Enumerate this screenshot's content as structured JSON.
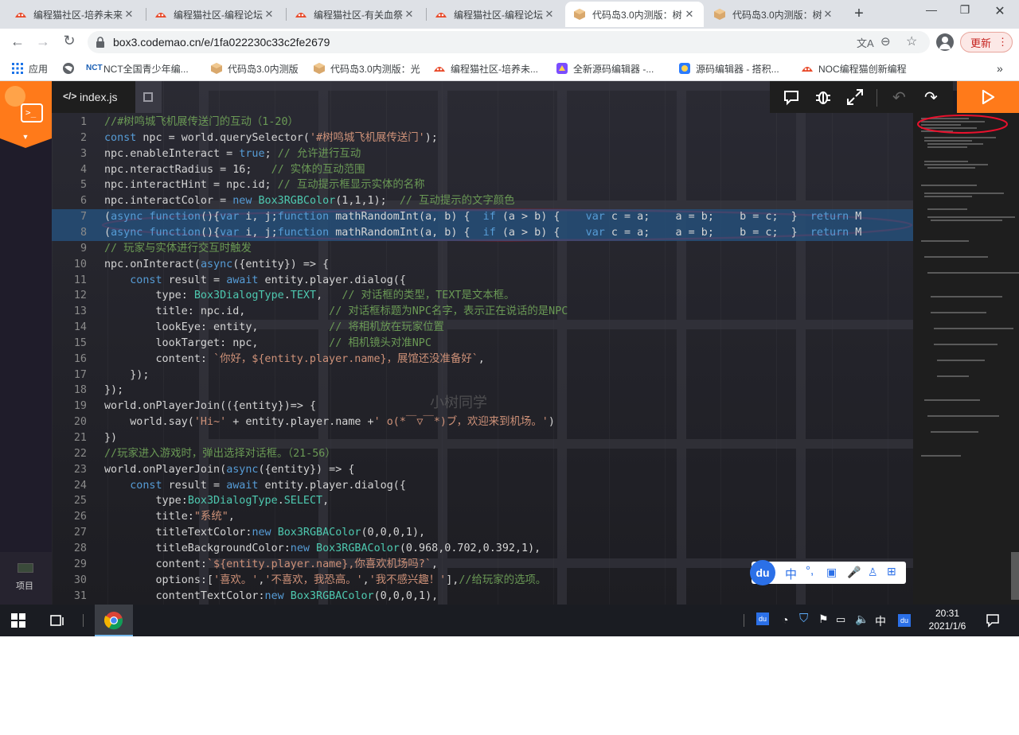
{
  "browser": {
    "tabs": [
      {
        "title": "编程猫社区-培养未来",
        "active": false
      },
      {
        "title": "编程猫社区-编程论坛",
        "active": false
      },
      {
        "title": "编程猫社区-有关血祭",
        "active": false
      },
      {
        "title": "编程猫社区-编程论坛",
        "active": false
      },
      {
        "title": "代码岛3.0内测版：树",
        "active": true
      },
      {
        "title": "代码岛3.0内测版：树",
        "active": false
      }
    ],
    "new_tab_icon": "plus-icon",
    "url": "box3.codemao.cn/e/1fa022230c33c2fe2679",
    "update_button": "更新",
    "bookmarks": [
      {
        "label": "应用"
      },
      {
        "label": ""
      },
      {
        "label": "NCT全国青少年编..."
      },
      {
        "label": "代码岛3.0内测版"
      },
      {
        "label": "代码岛3.0内测版：光"
      },
      {
        "label": "编程猫社区-培养未..."
      },
      {
        "label": "全新源码编辑器 -..."
      },
      {
        "label": "源码编辑器 - 搭积..."
      },
      {
        "label": "NOC编程猫创新编程"
      }
    ],
    "bookmarks_more": "»"
  },
  "editor": {
    "file_tab": "index.js",
    "sidebar_project_label": "项目",
    "colors": {
      "highlight": "#264f78",
      "accent": "#ff7a1a",
      "annotation": "#e8112d"
    },
    "ime_toolbar": [
      "du",
      "中",
      "°,",
      "工具箱",
      "麦克风",
      "用户",
      "菜单"
    ],
    "watermark": "小树同学",
    "lines": [
      {
        "n": "1",
        "text": "//#树鸣城飞机展传送门的互动（1-20）"
      },
      {
        "n": "2",
        "text": "const npc = world.querySelector('#树鸣城飞机展传送门');"
      },
      {
        "n": "3",
        "text": "npc.enableInteract = true; // 允许进行互动"
      },
      {
        "n": "4",
        "text": "npc.nteractRadius = 16;   // 实体的互动范围"
      },
      {
        "n": "5",
        "text": "npc.interactHint = npc.id; // 互动提示框显示实体的名称"
      },
      {
        "n": "6",
        "text": "npc.interactColor = new Box3RGBColor(1,1,1);  // 互动提示的文字颜色"
      },
      {
        "n": "7",
        "text": "(async function(){var i, j;function mathRandomInt(a, b) {  if (a > b) {    var c = a;    a = b;    b = c;  }  return M"
      },
      {
        "n": "8",
        "text": "(async function(){var i, j;function mathRandomInt(a, b) {  if (a > b) {    var c = a;    a = b;    b = c;  }  return M"
      },
      {
        "n": "9",
        "text": "// 玩家与实体进行交互时触发"
      },
      {
        "n": "10",
        "text": "npc.onInteract(async({entity}) => {"
      },
      {
        "n": "11",
        "text": "    const result = await entity.player.dialog({"
      },
      {
        "n": "12",
        "text": "        type: Box3DialogType.TEXT,   // 对话框的类型，TEXT是文本框。"
      },
      {
        "n": "13",
        "text": "        title: npc.id,             // 对话框标题为NPC名字，表示正在说话的是NPC"
      },
      {
        "n": "14",
        "text": "        lookEye: entity,           // 将相机放在玩家位置"
      },
      {
        "n": "15",
        "text": "        lookTarget: npc,           // 相机镜头对准NPC"
      },
      {
        "n": "16",
        "text": "        content: `你好，${entity.player.name}，展馆还没准备好`,"
      },
      {
        "n": "17",
        "text": "    });"
      },
      {
        "n": "18",
        "text": "});"
      },
      {
        "n": "19",
        "text": "world.onPlayerJoin(({entity})=> {"
      },
      {
        "n": "20",
        "text": "    world.say('Hi~' + entity.player.name +' o(*￣▽￣*)ブ，欢迎来到机场。')"
      },
      {
        "n": "21",
        "text": "})"
      },
      {
        "n": "22",
        "text": "//玩家进入游戏时，弹出选择对话框。（21-56）"
      },
      {
        "n": "23",
        "text": "world.onPlayerJoin(async({entity}) => {"
      },
      {
        "n": "24",
        "text": "    const result = await entity.player.dialog({"
      },
      {
        "n": "25",
        "text": "        type:Box3DialogType.SELECT,"
      },
      {
        "n": "26",
        "text": "        title:\"系统\","
      },
      {
        "n": "27",
        "text": "        titleTextColor:new Box3RGBAColor(0,0,0,1),"
      },
      {
        "n": "28",
        "text": "        titleBackgroundColor:new Box3RGBAColor(0.968,0.702,0.392,1),"
      },
      {
        "n": "29",
        "text": "        content:`${entity.player.name},你喜欢机场吗?`,"
      },
      {
        "n": "30",
        "text": "        options:['喜欢。','不喜欢，我恐高。','我不感兴趣！'],//给玩家的选项。"
      },
      {
        "n": "31",
        "text": "        contentTextColor:new Box3RGBAColor(0,0,0,1),"
      }
    ]
  },
  "taskbar": {
    "tray_items": [
      "du",
      "network-icon",
      "shield-icon",
      "flag-icon",
      "battery-icon",
      "volume-icon",
      "中",
      "du"
    ],
    "time": "20:31",
    "date": "2021/1/6"
  }
}
